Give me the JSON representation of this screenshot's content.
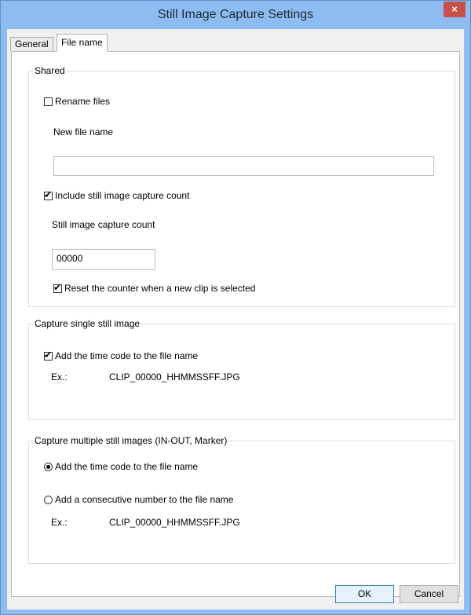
{
  "window": {
    "title": "Still Image Capture Settings",
    "close_label": "×"
  },
  "tabs": [
    {
      "label": "General",
      "active": false
    },
    {
      "label": "File name",
      "active": true
    }
  ],
  "shared": {
    "title": "Shared",
    "rename_files": {
      "label": "Rename files",
      "checked": false
    },
    "new_file_name_label": "New file name",
    "new_file_name_value": "",
    "include_count": {
      "label": "Include still image capture count",
      "checked": true
    },
    "count_label": "Still image capture count",
    "count_value": "00000",
    "reset_counter": {
      "label": "Reset the counter when a new clip is selected",
      "checked": true
    }
  },
  "single": {
    "title": "Capture single still image",
    "add_timecode": {
      "label": "Add the time code to the file name",
      "checked": true
    },
    "example_label": "Ex.:",
    "example_value": "CLIP_00000_HHMMSSFF.JPG"
  },
  "multiple": {
    "title": "Capture multiple still images (IN-OUT, Marker)",
    "add_timecode": {
      "label": "Add the time code to the file name",
      "selected": true
    },
    "add_number": {
      "label": "Add a consecutive number to the file name",
      "selected": false
    },
    "example_label": "Ex.:",
    "example_value": "CLIP_00000_HHMMSSFF.JPG"
  },
  "buttons": {
    "ok": "OK",
    "cancel": "Cancel"
  }
}
